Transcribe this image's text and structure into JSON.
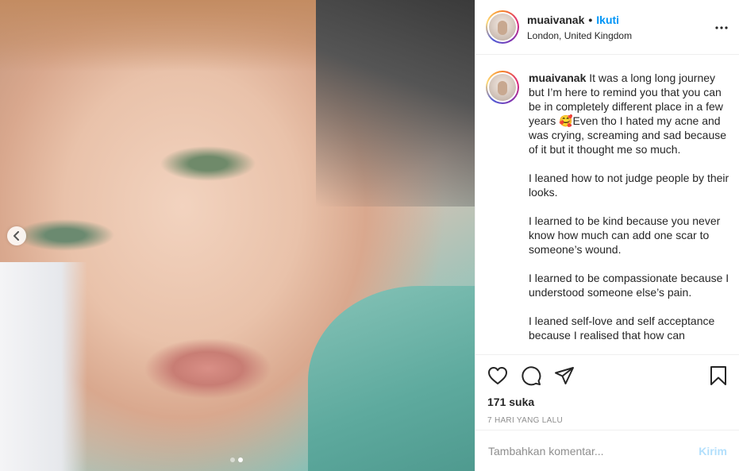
{
  "post": {
    "username": "muaivanak",
    "separator": "•",
    "follow_label": "Ikuti",
    "location": "London, United Kingdom",
    "caption_paragraphs": [
      "It was a long long journey but I’m here to remind you that you can be in completely different place in a few years 🥰Even tho I hated my acne and was crying, screaming and sad because of it but it thought me so much.",
      "I leaned how to not judge people by their looks.",
      "I learned to be kind because you never know how much can add one scar to someone’s wound.",
      "I learned to be compassionate because I understood someone else’s pain.",
      "I leaned self-love and self acceptance because I realised that how can"
    ],
    "likes": "171 suka",
    "time_ago": "7 HARI YANG LALU",
    "comment_placeholder": "Tambahkan komentar...",
    "post_label": "Kirim",
    "carousel": {
      "slides": 2,
      "active_slide": 2
    }
  },
  "icons": {
    "more": "more-options-icon",
    "like": "heart-icon",
    "comment": "comment-icon",
    "share": "share-icon",
    "save": "bookmark-icon",
    "prev": "chevron-left-icon"
  },
  "colors": {
    "link": "#0095f6",
    "post_disabled": "#b2dffc",
    "muted": "#8e8e8e",
    "border": "#efefef"
  }
}
